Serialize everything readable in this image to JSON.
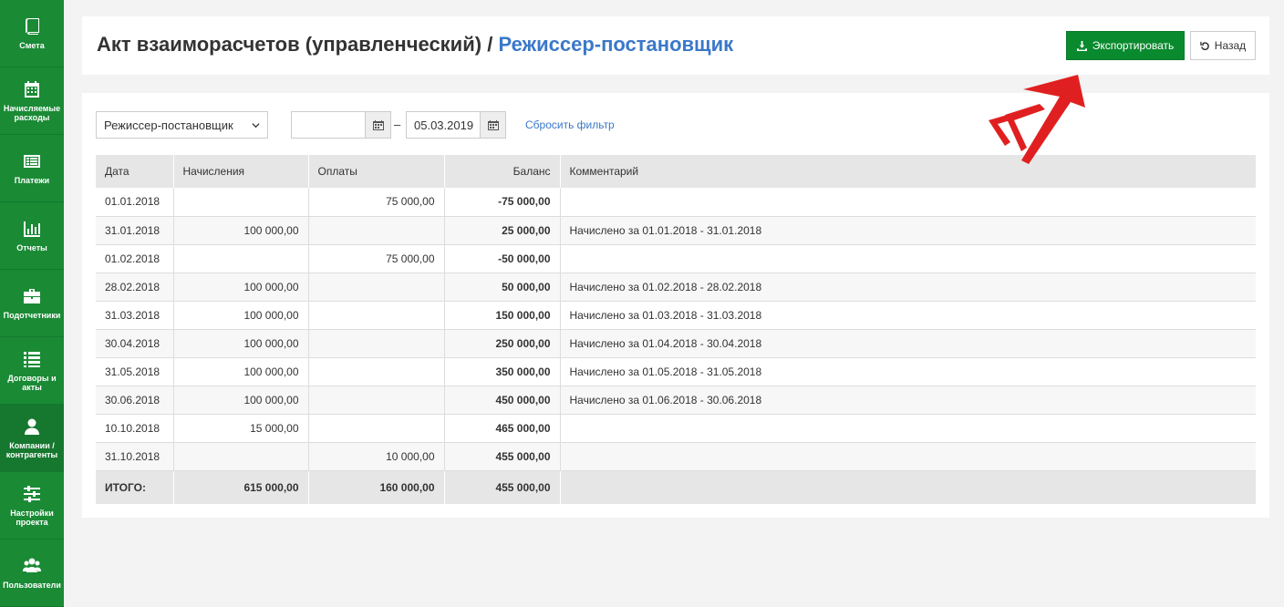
{
  "sidebar": {
    "items": [
      {
        "label": "Смета",
        "icon": "book-icon"
      },
      {
        "label": "Начисляемые расходы",
        "icon": "calendar-icon"
      },
      {
        "label": "Платежи",
        "icon": "list-alt-icon"
      },
      {
        "label": "Отчеты",
        "icon": "bar-chart-icon"
      },
      {
        "label": "Подотчетники",
        "icon": "briefcase-icon"
      },
      {
        "label": "Договоры и акты",
        "icon": "list-icon"
      },
      {
        "label": "Компании / контрагенты",
        "icon": "user-icon"
      },
      {
        "label": "Настройки проекта",
        "icon": "sliders-icon"
      },
      {
        "label": "Пользователи",
        "icon": "users-icon"
      }
    ]
  },
  "header": {
    "title": "Акт взаиморасчетов (управленческий)",
    "separator": "/",
    "subtitle": "Режиссер-постановщик",
    "export_label": "Экспортировать",
    "back_label": "Назад"
  },
  "filters": {
    "person": "Режиссер-постановщик",
    "date_from": "",
    "date_dash": "–",
    "date_to": "05.03.2019",
    "reset_label": "Сбросить фильтр"
  },
  "table": {
    "headers": [
      "Дата",
      "Начисления",
      "Оплаты",
      "Баланс",
      "Комментарий"
    ],
    "rows": [
      {
        "date": "01.01.2018",
        "accrual": "",
        "payment": "75 000,00",
        "balance": "-75 000,00",
        "comment": ""
      },
      {
        "date": "31.01.2018",
        "accrual": "100 000,00",
        "payment": "",
        "balance": "25 000,00",
        "comment": "Начислено за 01.01.2018 - 31.01.2018"
      },
      {
        "date": "01.02.2018",
        "accrual": "",
        "payment": "75 000,00",
        "balance": "-50 000,00",
        "comment": ""
      },
      {
        "date": "28.02.2018",
        "accrual": "100 000,00",
        "payment": "",
        "balance": "50 000,00",
        "comment": "Начислено за 01.02.2018 - 28.02.2018"
      },
      {
        "date": "31.03.2018",
        "accrual": "100 000,00",
        "payment": "",
        "balance": "150 000,00",
        "comment": "Начислено за 01.03.2018 - 31.03.2018"
      },
      {
        "date": "30.04.2018",
        "accrual": "100 000,00",
        "payment": "",
        "balance": "250 000,00",
        "comment": "Начислено за 01.04.2018 - 30.04.2018"
      },
      {
        "date": "31.05.2018",
        "accrual": "100 000,00",
        "payment": "",
        "balance": "350 000,00",
        "comment": "Начислено за 01.05.2018 - 31.05.2018"
      },
      {
        "date": "30.06.2018",
        "accrual": "100 000,00",
        "payment": "",
        "balance": "450 000,00",
        "comment": "Начислено за 01.06.2018 - 30.06.2018"
      },
      {
        "date": "10.10.2018",
        "accrual": "15 000,00",
        "payment": "",
        "balance": "465 000,00",
        "comment": ""
      },
      {
        "date": "31.10.2018",
        "accrual": "",
        "payment": "10 000,00",
        "balance": "455 000,00",
        "comment": ""
      }
    ],
    "totals": {
      "label": "ИТОГО:",
      "accrual": "615 000,00",
      "payment": "160 000,00",
      "balance": "455 000,00",
      "comment": ""
    }
  },
  "colors": {
    "sidebar": "#1a8a35",
    "export_button": "#0a8a2e",
    "link": "#3a78c9",
    "arrow": "#e02020"
  }
}
